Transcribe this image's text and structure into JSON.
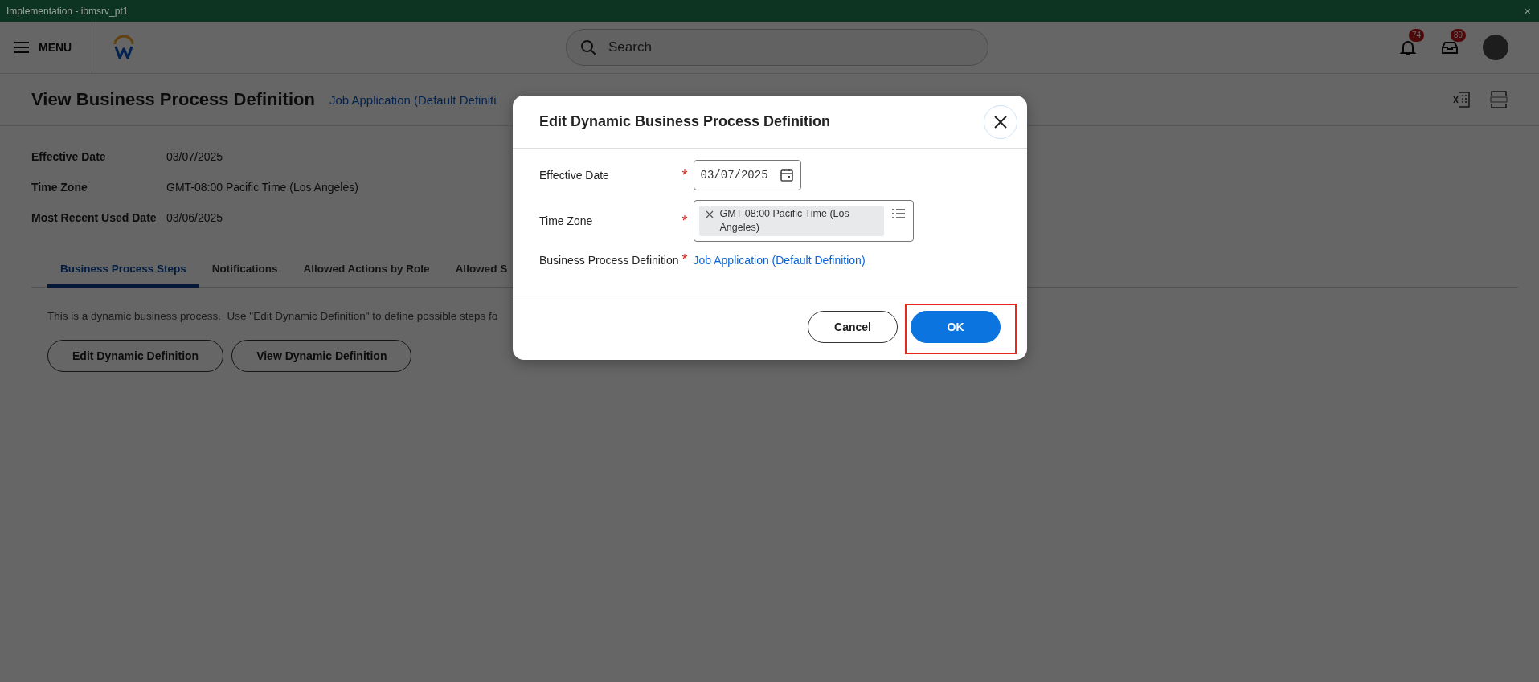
{
  "window": {
    "title": "Implementation - ibmsrv_pt1",
    "close": "×"
  },
  "header": {
    "menu": "MENU",
    "search": {
      "placeholder": "Search"
    },
    "notifications": "74",
    "inbox": "89"
  },
  "page": {
    "title": "View Business Process Definition",
    "subtitle_link": "Job Application (Default Definiti",
    "fields": [
      {
        "label": "Effective Date",
        "value": "03/07/2025"
      },
      {
        "label": "Time Zone",
        "value": "GMT-08:00 Pacific Time (Los Angeles)"
      },
      {
        "label": "Most Recent Used Date",
        "value": "03/06/2025"
      }
    ],
    "tabs": [
      {
        "label": "Business Process Steps",
        "selected": true
      },
      {
        "label": "Notifications",
        "selected": false
      },
      {
        "label": "Allowed Actions by Role",
        "selected": false
      },
      {
        "label": "Allowed S",
        "selected": false
      }
    ],
    "description": "This is a dynamic business process.  Use \"Edit Dynamic Definition\" to define possible steps fo",
    "buttons": [
      "Edit Dynamic Definition",
      "View Dynamic Definition"
    ]
  },
  "dialog": {
    "title": "Edit Dynamic Business Process Definition",
    "fields": [
      {
        "kind": "date",
        "label": "Effective Date",
        "required_mark": "*",
        "value": "03/07/2025"
      },
      {
        "kind": "multiselect",
        "label": "Time Zone",
        "required_mark": "*",
        "value": "GMT-08:00 Pacific Time (Los Angeles)"
      },
      {
        "kind": "link",
        "label": "Business Process Definition",
        "required_mark": "*",
        "value": "Job Application (Default Definition)"
      }
    ],
    "buttons": [
      {
        "label": "Cancel",
        "primary": false,
        "highlighted": false
      },
      {
        "label": "OK",
        "primary": true,
        "highlighted": true
      }
    ]
  }
}
